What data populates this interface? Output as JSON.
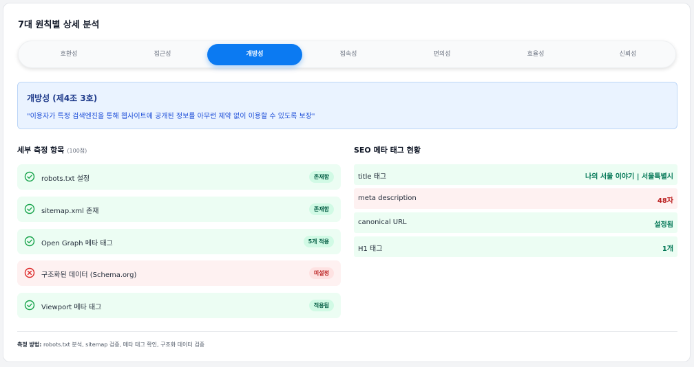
{
  "section_title": "7대 원칙별 상세 분석",
  "tabs": [
    "호환성",
    "접근성",
    "개방성",
    "접속성",
    "편의성",
    "효율성",
    "신뢰성"
  ],
  "active_tab": "개방성",
  "info": {
    "title": "개방성 (제4조 3호)",
    "quote": "\"이용자가 특정 검색엔진을 통해 웹사이트에 공개된 정보를 아무런 제약 없이 이용할 수 있도록 보장\""
  },
  "details": {
    "title": "세부 측정 항목",
    "points": "(100점)",
    "items": [
      {
        "label": "robots.txt 설정",
        "status": "존재함",
        "state": "ok",
        "icon": "check-circle-icon"
      },
      {
        "label": "sitemap.xml 존재",
        "status": "존재함",
        "state": "ok",
        "icon": "check-circle-icon"
      },
      {
        "label": "Open Graph 메타 태그",
        "status": "5개 적용",
        "state": "ok",
        "icon": "check-circle-icon"
      },
      {
        "label": "구조화된 데이터 (Schema.org)",
        "status": "미설정",
        "state": "bad",
        "icon": "x-circle-icon"
      },
      {
        "label": "Viewport 메타 태그",
        "status": "적용됨",
        "state": "ok",
        "icon": "check-circle-icon"
      }
    ]
  },
  "seo": {
    "title": "SEO 메타 태그 현황",
    "rows": [
      {
        "label": "title 태그",
        "value": "나의 서울 이야기 | 서울특별시",
        "state": "ok"
      },
      {
        "label": "meta description",
        "value": "48자",
        "state": "bad"
      },
      {
        "label": "canonical URL",
        "value": "설정됨",
        "state": "ok"
      },
      {
        "label": "H1 태그",
        "value": "1개",
        "state": "ok"
      }
    ]
  },
  "footer": {
    "label": "측정 방법:",
    "text": " robots.txt 분석, sitemap 검증, 메타 태그 확인, 구조화 데이터 검증"
  },
  "colors": {
    "accent": "#0b7af2",
    "ok": "#16a34a",
    "bad": "#dc2626"
  }
}
